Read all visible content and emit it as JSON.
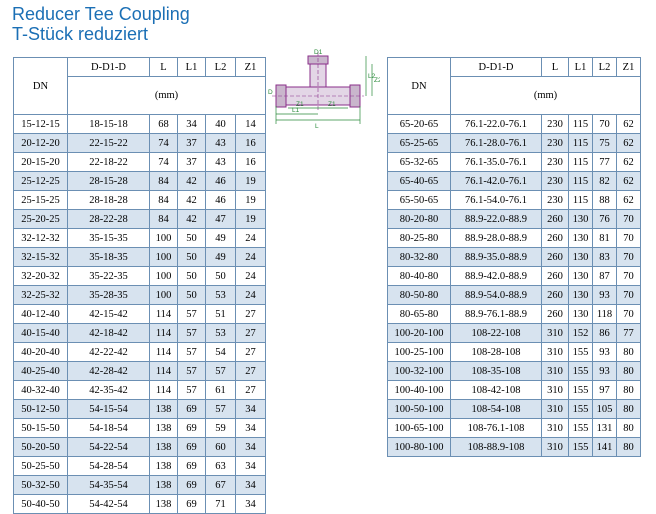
{
  "title": {
    "line1": "Reducer Tee Coupling",
    "line2": "T-Stück reduziert"
  },
  "colors": {
    "title": "#1b6fb5",
    "border": "#6b8fb3",
    "row_shade": "#d7e3ef",
    "drawing": "#8a2f8a",
    "dimension": "#2a8a3a"
  },
  "diagram": {
    "labels": {
      "d1": "D1",
      "z2": "Z2",
      "l2": "L2",
      "z1a": "Z1",
      "z1b": "Z1",
      "l1": "L1",
      "l": "L",
      "d": "D"
    }
  },
  "table_left": {
    "headers": {
      "dn": "DN",
      "d": "D-D1-D",
      "l": "L",
      "l1": "L1",
      "l2": "L2",
      "z1": "Z1",
      "unit": "(mm)"
    },
    "rows": [
      [
        "15-12-15",
        "18-15-18",
        "68",
        "34",
        "40",
        "14"
      ],
      [
        "20-12-20",
        "22-15-22",
        "74",
        "37",
        "43",
        "16"
      ],
      [
        "20-15-20",
        "22-18-22",
        "74",
        "37",
        "43",
        "16"
      ],
      [
        "25-12-25",
        "28-15-28",
        "84",
        "42",
        "46",
        "19"
      ],
      [
        "25-15-25",
        "28-18-28",
        "84",
        "42",
        "46",
        "19"
      ],
      [
        "25-20-25",
        "28-22-28",
        "84",
        "42",
        "47",
        "19"
      ],
      [
        "32-12-32",
        "35-15-35",
        "100",
        "50",
        "49",
        "24"
      ],
      [
        "32-15-32",
        "35-18-35",
        "100",
        "50",
        "49",
        "24"
      ],
      [
        "32-20-32",
        "35-22-35",
        "100",
        "50",
        "50",
        "24"
      ],
      [
        "32-25-32",
        "35-28-35",
        "100",
        "50",
        "53",
        "24"
      ],
      [
        "40-12-40",
        "42-15-42",
        "114",
        "57",
        "51",
        "27"
      ],
      [
        "40-15-40",
        "42-18-42",
        "114",
        "57",
        "53",
        "27"
      ],
      [
        "40-20-40",
        "42-22-42",
        "114",
        "57",
        "54",
        "27"
      ],
      [
        "40-25-40",
        "42-28-42",
        "114",
        "57",
        "57",
        "27"
      ],
      [
        "40-32-40",
        "42-35-42",
        "114",
        "57",
        "61",
        "27"
      ],
      [
        "50-12-50",
        "54-15-54",
        "138",
        "69",
        "57",
        "34"
      ],
      [
        "50-15-50",
        "54-18-54",
        "138",
        "69",
        "59",
        "34"
      ],
      [
        "50-20-50",
        "54-22-54",
        "138",
        "69",
        "60",
        "34"
      ],
      [
        "50-25-50",
        "54-28-54",
        "138",
        "69",
        "63",
        "34"
      ],
      [
        "50-32-50",
        "54-35-54",
        "138",
        "69",
        "67",
        "34"
      ],
      [
        "50-40-50",
        "54-42-54",
        "138",
        "69",
        "71",
        "34"
      ]
    ]
  },
  "table_right": {
    "headers": {
      "dn": "DN",
      "d": "D-D1-D",
      "l": "L",
      "l1": "L1",
      "l2": "L2",
      "z1": "Z1",
      "unit": "(mm)"
    },
    "rows": [
      [
        "65-20-65",
        "76.1-22.0-76.1",
        "230",
        "115",
        "70",
        "62"
      ],
      [
        "65-25-65",
        "76.1-28.0-76.1",
        "230",
        "115",
        "75",
        "62"
      ],
      [
        "65-32-65",
        "76.1-35.0-76.1",
        "230",
        "115",
        "77",
        "62"
      ],
      [
        "65-40-65",
        "76.1-42.0-76.1",
        "230",
        "115",
        "82",
        "62"
      ],
      [
        "65-50-65",
        "76.1-54.0-76.1",
        "230",
        "115",
        "88",
        "62"
      ],
      [
        "80-20-80",
        "88.9-22.0-88.9",
        "260",
        "130",
        "76",
        "70"
      ],
      [
        "80-25-80",
        "88.9-28.0-88.9",
        "260",
        "130",
        "81",
        "70"
      ],
      [
        "80-32-80",
        "88.9-35.0-88.9",
        "260",
        "130",
        "83",
        "70"
      ],
      [
        "80-40-80",
        "88.9-42.0-88.9",
        "260",
        "130",
        "87",
        "70"
      ],
      [
        "80-50-80",
        "88.9-54.0-88.9",
        "260",
        "130",
        "93",
        "70"
      ],
      [
        "80-65-80",
        "88.9-76.1-88.9",
        "260",
        "130",
        "118",
        "70"
      ],
      [
        "100-20-100",
        "108-22-108",
        "310",
        "152",
        "86",
        "77"
      ],
      [
        "100-25-100",
        "108-28-108",
        "310",
        "155",
        "93",
        "80"
      ],
      [
        "100-32-100",
        "108-35-108",
        "310",
        "155",
        "93",
        "80"
      ],
      [
        "100-40-100",
        "108-42-108",
        "310",
        "155",
        "97",
        "80"
      ],
      [
        "100-50-100",
        "108-54-108",
        "310",
        "155",
        "105",
        "80"
      ],
      [
        "100-65-100",
        "108-76.1-108",
        "310",
        "155",
        "131",
        "80"
      ],
      [
        "100-80-100",
        "108-88.9-108",
        "310",
        "155",
        "141",
        "80"
      ]
    ]
  }
}
